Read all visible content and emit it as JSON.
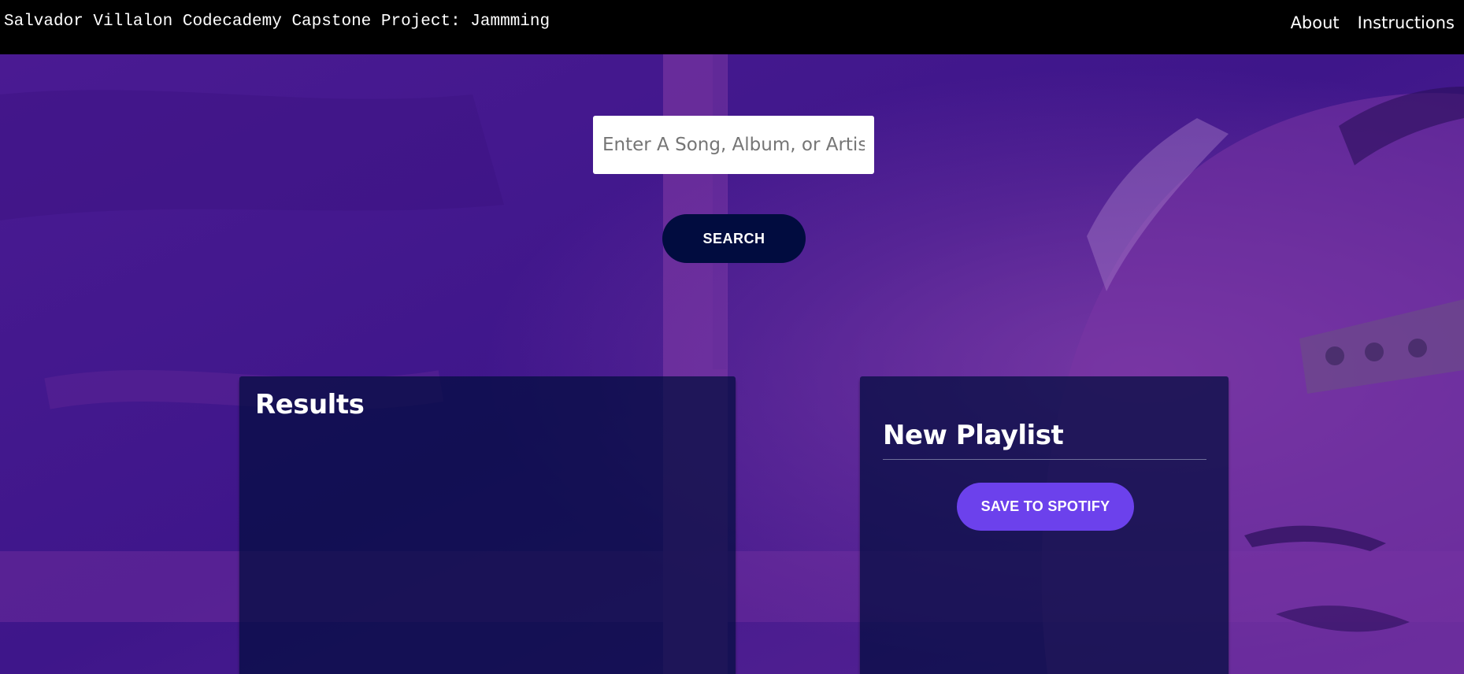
{
  "header": {
    "title": "Salvador Villalon Codecademy Capstone Project: Jammming",
    "nav": [
      {
        "label": "About"
      },
      {
        "label": "Instructions"
      }
    ]
  },
  "search": {
    "placeholder": "Enter A Song, Album, or Artist",
    "value": "",
    "button_label": "SEARCH"
  },
  "results": {
    "title": "Results"
  },
  "playlist": {
    "title": "New Playlist",
    "save_label": "SAVE TO SPOTIFY"
  },
  "colors": {
    "background": "#4a1a92",
    "topbar": "#000000",
    "search_button": "#010c3f",
    "save_button": "#6c41ec",
    "panel": "#010c3f"
  }
}
